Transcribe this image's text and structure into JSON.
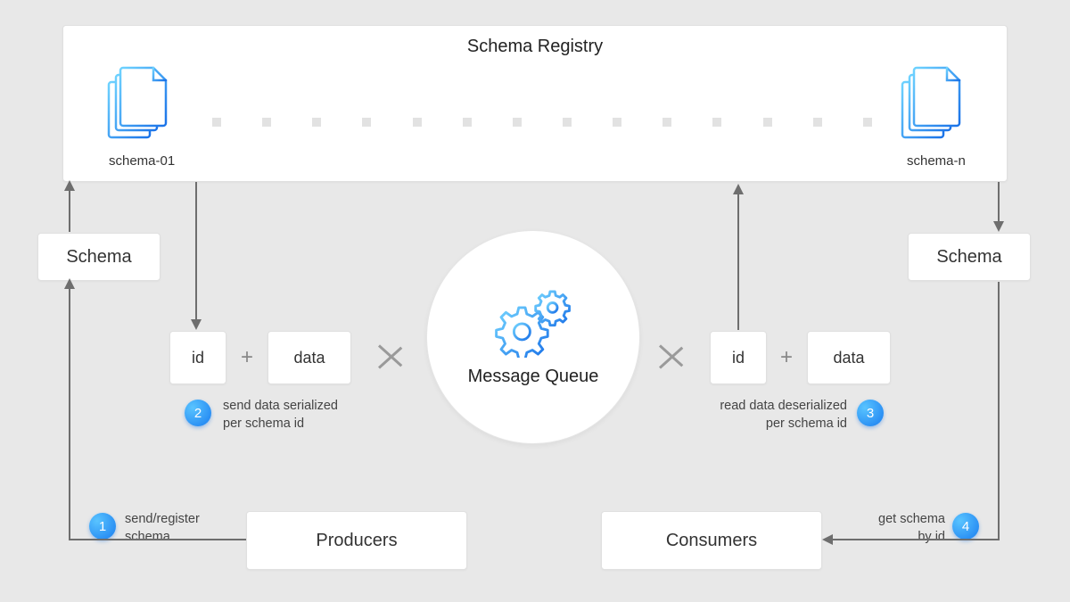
{
  "registry": {
    "title": "Schema Registry",
    "schema_left_label": "schema-01",
    "schema_right_label": "schema-n"
  },
  "schema_box_left": "Schema",
  "schema_box_right": "Schema",
  "message_queue": "Message Queue",
  "producer_box": "Producers",
  "consumer_box": "Consumers",
  "id_label": "id",
  "data_label": "data",
  "plus": "+",
  "steps": {
    "s1": {
      "num": "1",
      "text1": "send/register",
      "text2": "schema"
    },
    "s2": {
      "num": "2",
      "text1": "send data serialized",
      "text2": "per schema id"
    },
    "s3": {
      "num": "3",
      "text1": "read data deserialized",
      "text2": "per schema id"
    },
    "s4": {
      "num": "4",
      "text1": "get schema",
      "text2": "by id"
    }
  }
}
